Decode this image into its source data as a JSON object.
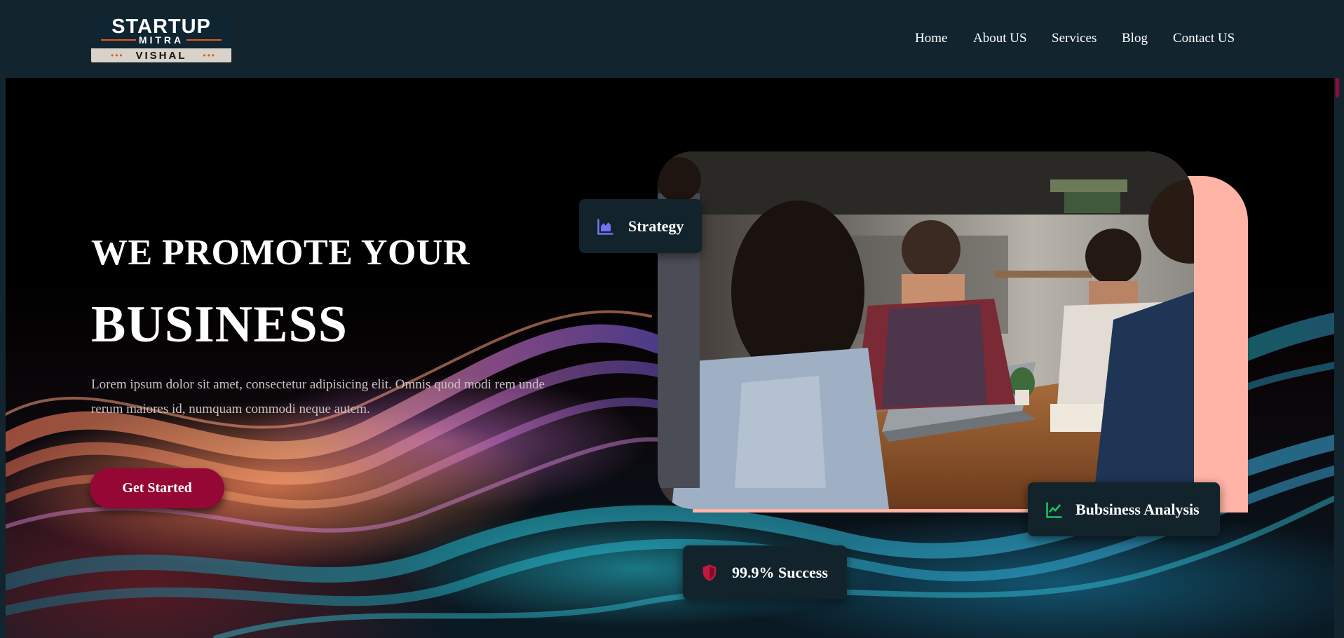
{
  "logo": {
    "title": "STARTUP",
    "subtitle": "MITRA",
    "name": "VISHAL",
    "dots": "•••"
  },
  "nav": {
    "items": [
      "Home",
      "About US",
      "Services",
      "Blog",
      "Contact US"
    ]
  },
  "hero": {
    "title_line1": "WE PROMOTE YOUR",
    "title_line2": "BUSINESS",
    "description": "Lorem ipsum dolor sit amet, consectetur adipisicing elit. Omnis quod modi rem unde rerum maiores id, numquam commodi neque autem.",
    "cta_label": "Get Started"
  },
  "badges": {
    "strategy": "Strategy",
    "analysis": "Bubsiness Analysis",
    "success": "99.9% Success"
  },
  "colors": {
    "navbar": "#12252f",
    "cta": "#950835",
    "photo_accent": "#ffb4a6",
    "strategy_icon": "#6f74f2",
    "analysis_icon": "#1fc063",
    "success_icon": "#c5173f"
  },
  "icons": {
    "strategy": "area-chart-icon",
    "analysis": "line-chart-icon",
    "success": "shield-icon"
  }
}
